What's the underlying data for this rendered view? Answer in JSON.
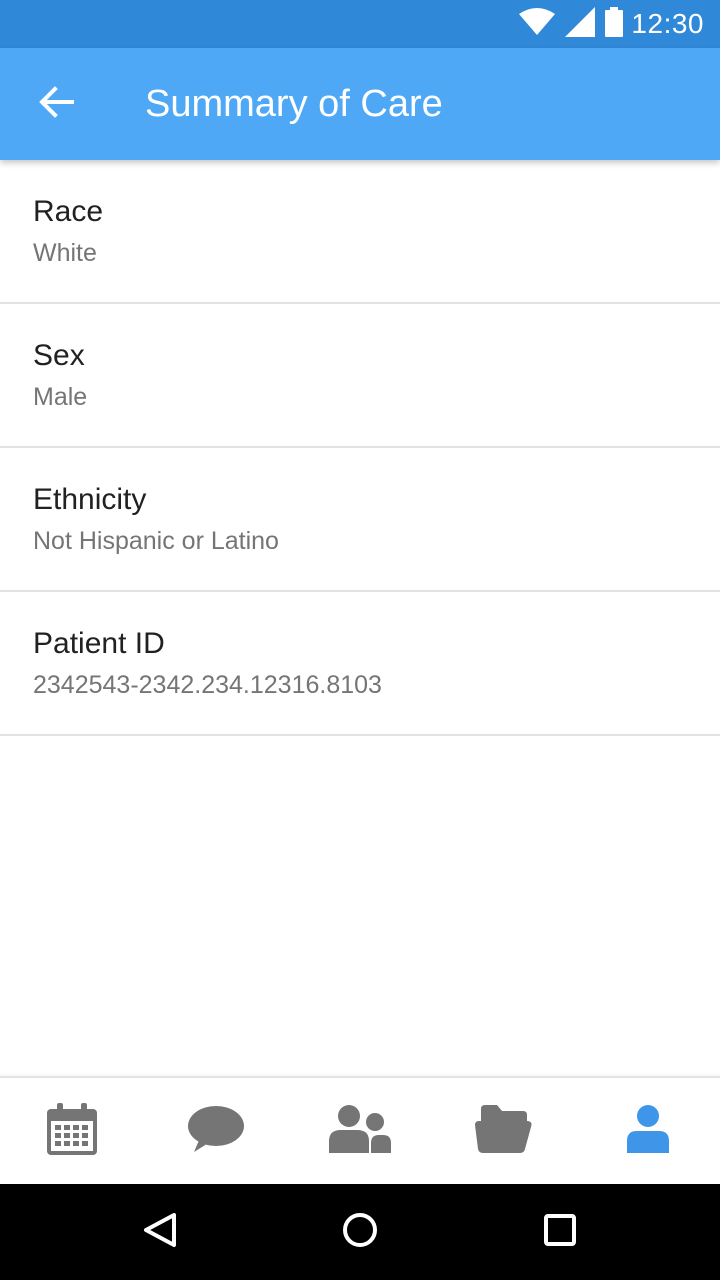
{
  "status_bar": {
    "time": "12:30",
    "icons": [
      "wifi-icon",
      "signal-icon",
      "battery-icon"
    ],
    "color": "#3088d8"
  },
  "app_bar": {
    "title": "Summary of Care",
    "back_icon": "arrow-left-icon",
    "color": "#4fa8f5"
  },
  "fields": [
    {
      "label": "Race",
      "value": "White"
    },
    {
      "label": "Sex",
      "value": "Male"
    },
    {
      "label": "Ethnicity",
      "value": "Not Hispanic or Latino"
    },
    {
      "label": "Patient ID",
      "value": "2342543-2342.234.12316.8103"
    }
  ],
  "bottom_nav": {
    "items": [
      {
        "icon": "calendar-icon",
        "active": false
      },
      {
        "icon": "chat-bubble-icon",
        "active": false
      },
      {
        "icon": "people-icon",
        "active": false
      },
      {
        "icon": "folder-open-icon",
        "active": false
      },
      {
        "icon": "person-icon",
        "active": true
      }
    ],
    "inactive_color": "#757575",
    "active_color": "#3f95e8"
  },
  "system_nav": {
    "buttons": [
      "back-triangle-icon",
      "home-circle-icon",
      "recents-square-icon"
    ]
  }
}
